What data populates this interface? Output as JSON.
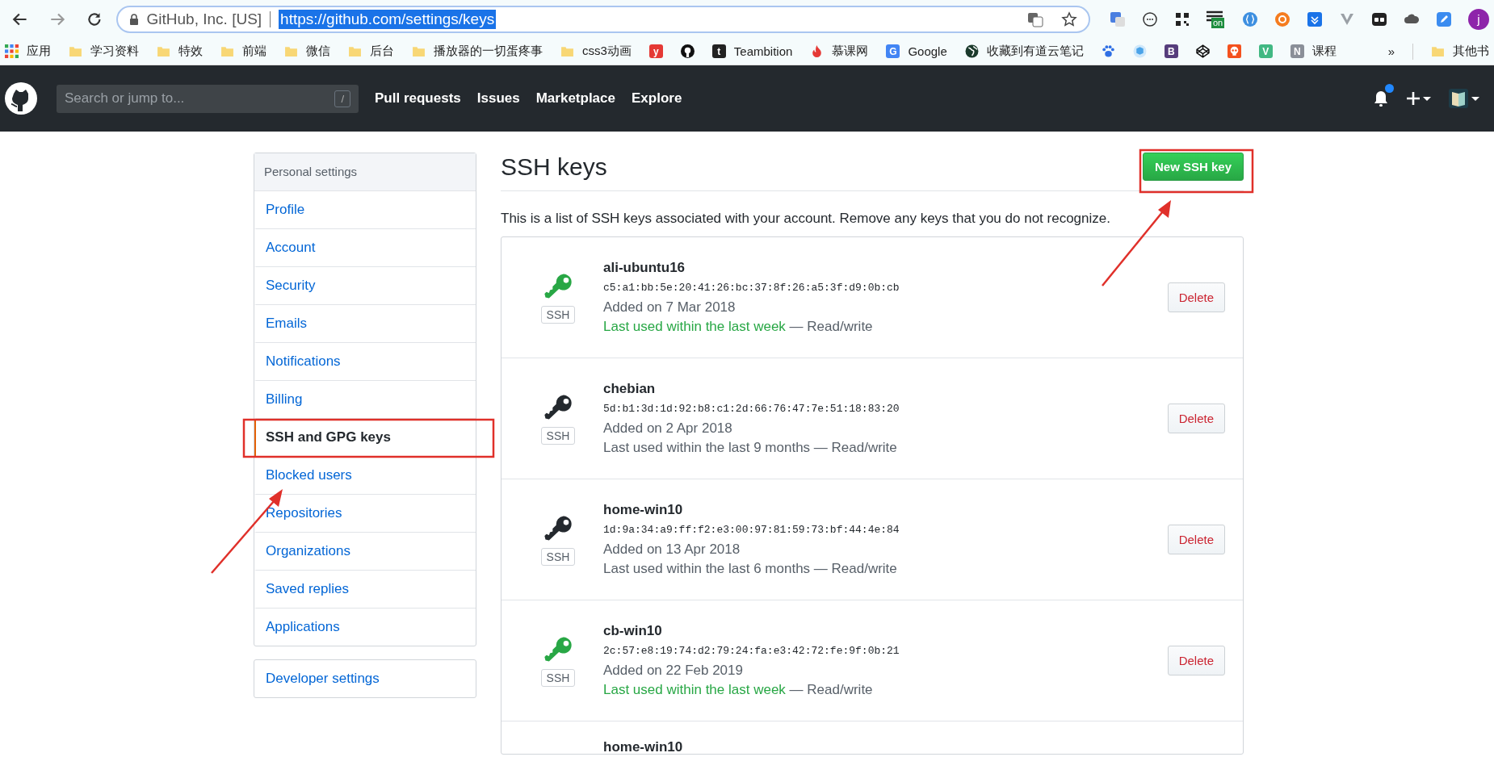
{
  "browser": {
    "site_name": "GitHub, Inc. [US]",
    "url": "https://github.com/settings/keys",
    "url_selected": true,
    "extension_badge": "on",
    "profile_initial": "j"
  },
  "bookmarks": [
    {
      "kind": "apps",
      "label": "应用"
    },
    {
      "kind": "folder",
      "label": "学习资料"
    },
    {
      "kind": "folder",
      "label": "特效"
    },
    {
      "kind": "folder",
      "label": "前端"
    },
    {
      "kind": "folder",
      "label": "微信"
    },
    {
      "kind": "folder",
      "label": "后台"
    },
    {
      "kind": "folder",
      "label": "播放器的一切蛋疼事"
    },
    {
      "kind": "folder",
      "label": "css3动画"
    },
    {
      "kind": "glyph",
      "glyph": "y",
      "color": "#e53935"
    },
    {
      "kind": "github"
    },
    {
      "kind": "glyph",
      "glyph": "t",
      "color": "#222222",
      "label": "Teambition"
    },
    {
      "kind": "fire",
      "label": "慕课网"
    },
    {
      "kind": "glyph",
      "glyph": "G",
      "color": "#4285f4",
      "label": "Google"
    },
    {
      "kind": "globe",
      "label": "收藏到有道云笔记"
    },
    {
      "kind": "paw"
    },
    {
      "kind": "cube"
    },
    {
      "kind": "glyph",
      "glyph": "B",
      "color": "#563d7c"
    },
    {
      "kind": "codepen"
    },
    {
      "kind": "skull"
    },
    {
      "kind": "glyph",
      "glyph": "V",
      "color": "#41b883"
    },
    {
      "kind": "glyph",
      "glyph": "N",
      "color": "#8a8f98",
      "label": "课程"
    }
  ],
  "bookmarks_overflow": "»",
  "other_bookmarks": "其他书",
  "header": {
    "search_placeholder": "Search or jump to...",
    "search_key": "/",
    "nav": [
      "Pull requests",
      "Issues",
      "Marketplace",
      "Explore"
    ],
    "notifications_unread": true
  },
  "sidebar": {
    "heading": "Personal settings",
    "items": [
      {
        "label": "Profile",
        "selected": false
      },
      {
        "label": "Account",
        "selected": false
      },
      {
        "label": "Security",
        "selected": false
      },
      {
        "label": "Emails",
        "selected": false
      },
      {
        "label": "Notifications",
        "selected": false
      },
      {
        "label": "Billing",
        "selected": false
      },
      {
        "label": "SSH and GPG keys",
        "selected": true
      },
      {
        "label": "Blocked users",
        "selected": false
      },
      {
        "label": "Repositories",
        "selected": false
      },
      {
        "label": "Organizations",
        "selected": false
      },
      {
        "label": "Saved replies",
        "selected": false
      },
      {
        "label": "Applications",
        "selected": false
      }
    ],
    "developer_settings": "Developer settings"
  },
  "main": {
    "title": "SSH keys",
    "new_button": "New SSH key",
    "description": "This is a list of SSH keys associated with your account. Remove any keys that you do not recognize.",
    "keys": [
      {
        "name": "ali-ubuntu16",
        "type": "SSH",
        "fingerprint": "c5:a1:bb:5e:20:41:26:bc:37:8f:26:a5:3f:d9:0b:cb",
        "added": "Added on 7 Mar 2018",
        "last_used": "Last used within the last week",
        "access": " — Read/write",
        "recent": true,
        "delete": "Delete"
      },
      {
        "name": "chebian",
        "type": "SSH",
        "fingerprint": "5d:b1:3d:1d:92:b8:c1:2d:66:76:47:7e:51:18:83:20",
        "added": "Added on 2 Apr 2018",
        "last_used": "Last used within the last 9 months",
        "access": " — Read/write",
        "recent": false,
        "delete": "Delete"
      },
      {
        "name": "home-win10",
        "type": "SSH",
        "fingerprint": "1d:9a:34:a9:ff:f2:e3:00:97:81:59:73:bf:44:4e:84",
        "added": "Added on 13 Apr 2018",
        "last_used": "Last used within the last 6 months",
        "access": " — Read/write",
        "recent": false,
        "delete": "Delete"
      },
      {
        "name": "cb-win10",
        "type": "SSH",
        "fingerprint": "2c:57:e8:19:74:d2:79:24:fa:e3:42:72:fe:9f:0b:21",
        "added": "Added on 22 Feb 2019",
        "last_used": "Last used within the last week",
        "access": " — Read/write",
        "recent": true,
        "delete": "Delete"
      }
    ],
    "partial_key_name": "home-win10"
  }
}
